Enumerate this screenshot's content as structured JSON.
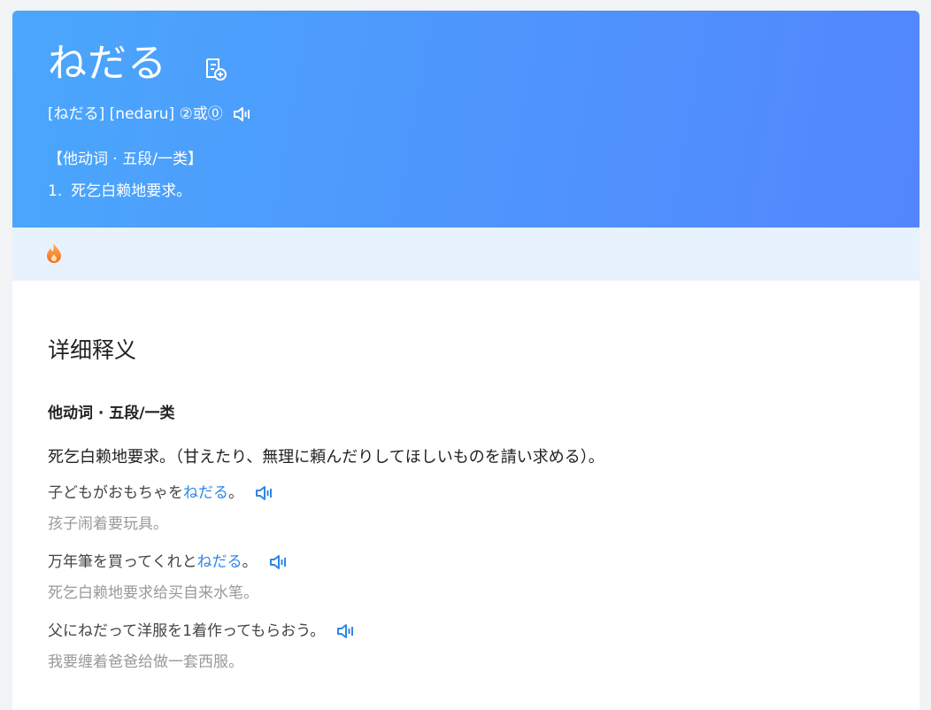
{
  "entry": {
    "word": "ねだる",
    "pronunciation": "[ねだる] [nedaru] ②或⓪",
    "pos": "【他动词 · 五段/一类】",
    "definitions": [
      {
        "num": "1.",
        "text": "死乞白赖地要求。"
      }
    ]
  },
  "detail": {
    "section_title": "详细释义",
    "pos": "他动词 · 五段/一类",
    "meaning": "死乞白赖地要求。（甘えたり、無理に頼んだりしてほしいものを請い求める）。",
    "examples": [
      {
        "before": "子どもがおもちゃを",
        "highlight": "ねだる",
        "after": "。",
        "translation": "孩子闹着要玩具。"
      },
      {
        "before": "万年筆を買ってくれと",
        "highlight": "ねだる",
        "after": "。",
        "translation": "死乞白赖地要求给买自来水笔。"
      },
      {
        "before": "父にねだって洋服を1着作ってもらおう。",
        "highlight": "",
        "after": "",
        "translation": "我要缠着爸爸给做一套西服。"
      }
    ]
  },
  "icons": {
    "add_wordbook": "add-to-wordbook-icon",
    "speaker": "speaker-icon",
    "hot": "fire-icon"
  },
  "colors": {
    "hero_start": "#4aa7fb",
    "hero_end": "#5386fd",
    "strip": "#e8f2fd",
    "highlight": "#2f86e6",
    "translation": "#999999"
  }
}
